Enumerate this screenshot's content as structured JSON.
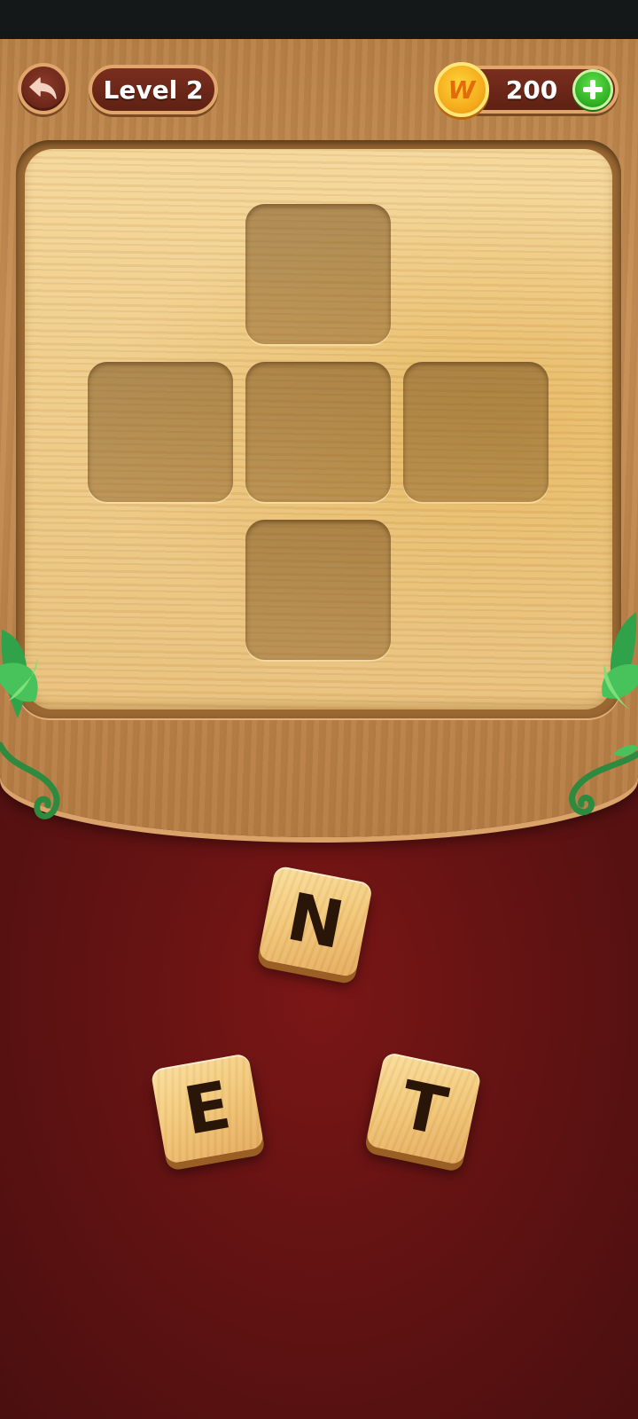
{
  "header": {
    "level_label": "Level 2",
    "coins": "200",
    "coin_symbol": "W"
  },
  "board": {
    "cells": [
      {
        "row": 0,
        "col": 1,
        "filled": false
      },
      {
        "row": 1,
        "col": 0,
        "filled": false
      },
      {
        "row": 1,
        "col": 1,
        "filled": false
      },
      {
        "row": 1,
        "col": 2,
        "filled": false
      },
      {
        "row": 2,
        "col": 1,
        "filled": false
      }
    ]
  },
  "letters": [
    "N",
    "E",
    "T"
  ],
  "colors": {
    "accent_gold": "#f4a91a",
    "add_green": "#2fae22",
    "background_red": "#661313",
    "wood": "#c78f55"
  }
}
